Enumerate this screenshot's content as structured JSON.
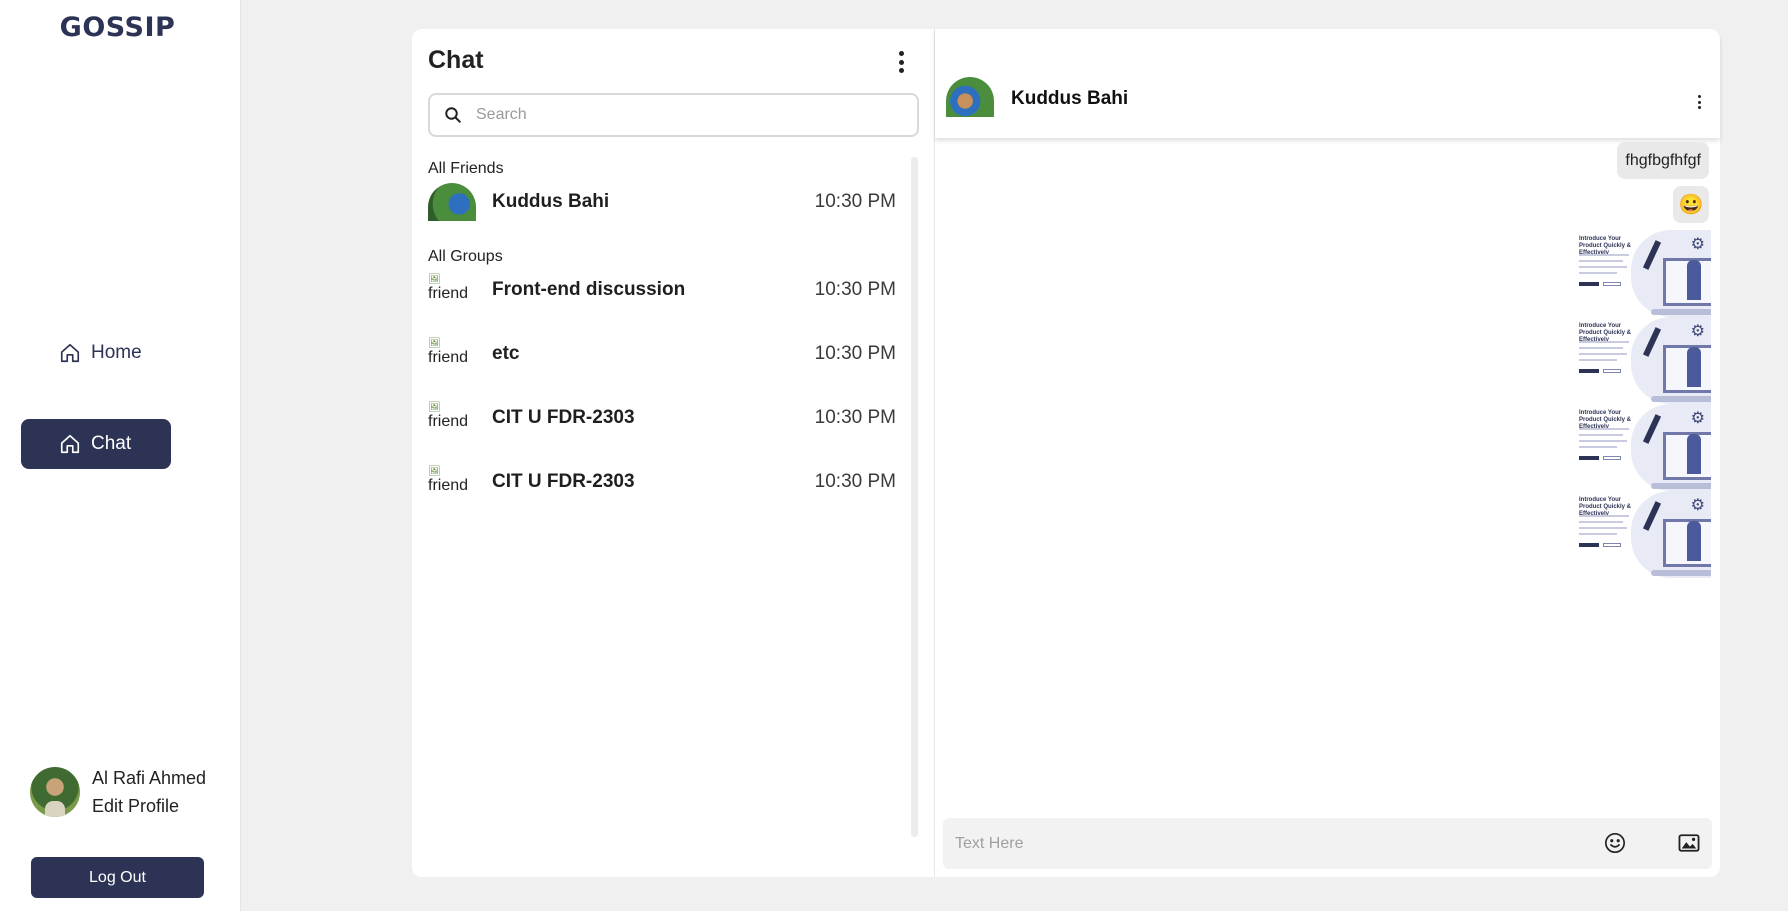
{
  "app": {
    "logo": "GOSSIP"
  },
  "sidebar": {
    "nav": [
      {
        "label": "Home",
        "icon": "home-icon",
        "active": false
      },
      {
        "label": "Chat",
        "icon": "home-icon",
        "active": true
      }
    ],
    "user": {
      "name": "Al Rafi Ahmed",
      "edit_label": "Edit Profile"
    },
    "logout_label": "Log Out"
  },
  "chat_list": {
    "title": "Chat",
    "search": {
      "placeholder": "Search",
      "value": ""
    },
    "friends_label": "All Friends",
    "friends": [
      {
        "name": "Kuddus Bahi",
        "time": "10:30 PM"
      }
    ],
    "groups_label": "All Groups",
    "groups": [
      {
        "name": "Front-end discussion",
        "time": "10:30 PM",
        "alt": "friend"
      },
      {
        "name": "etc",
        "time": "10:30 PM",
        "alt": "friend"
      },
      {
        "name": "CIT U FDR-2303",
        "time": "10:30 PM",
        "alt": "friend"
      },
      {
        "name": "CIT U FDR-2303",
        "time": "10:30 PM",
        "alt": "friend"
      }
    ]
  },
  "conversation": {
    "contact_name": "Kuddus Bahi",
    "messages": [
      {
        "type": "text",
        "text": "fhgfbgfhfgf"
      },
      {
        "type": "emoji",
        "text": "😀"
      },
      {
        "type": "image",
        "headline": "Introduce Your Product Quickly & Effectively"
      },
      {
        "type": "image",
        "headline": "Introduce Your Product Quickly & Effectively"
      },
      {
        "type": "image",
        "headline": "Introduce Your Product Quickly & Effectively"
      },
      {
        "type": "image",
        "headline": "Introduce Your Product Quickly & Effectively"
      }
    ],
    "composer": {
      "placeholder": "Text Here",
      "value": ""
    }
  },
  "colors": {
    "brand": "#2d3355",
    "background": "#f0f0f0",
    "bubble": "#e9e9e9"
  }
}
